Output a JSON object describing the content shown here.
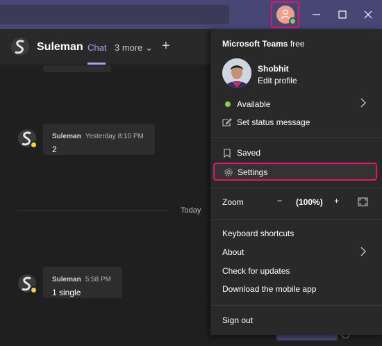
{
  "header": {
    "contact_name": "Suleman",
    "tab_chat": "Chat",
    "tab_more": "3 more",
    "add_tab": "+"
  },
  "messages": [
    {
      "sender": "Suleman",
      "time": "Yesterday 8:10 PM",
      "text": "2"
    },
    {
      "sender": "Suleman",
      "time": "5:58 PM",
      "text": "1 single"
    }
  ],
  "divider": {
    "label": "Today"
  },
  "menu": {
    "product": "Microsoft Teams",
    "tier": "free",
    "profile_name": "Shobhit",
    "edit_profile": "Edit profile",
    "status": "Available",
    "set_status": "Set status message",
    "saved": "Saved",
    "settings": "Settings",
    "zoom_label": "Zoom",
    "zoom_minus": "−",
    "zoom_value": "(100%)",
    "zoom_plus": "+",
    "keyboard_shortcuts": "Keyboard shortcuts",
    "about": "About",
    "check_updates": "Check for updates",
    "download_mobile": "Download the mobile app",
    "sign_out": "Sign out"
  },
  "colors": {
    "titlebar": "#464775",
    "accent": "#a5a7e5",
    "highlight": "#e0166d",
    "available": "#92c353",
    "away": "#f8d22a"
  },
  "icons": [
    "search-icon",
    "profile-avatar-icon",
    "minimize-icon",
    "maximize-icon",
    "close-icon",
    "chevron-right-icon",
    "bookmark-icon",
    "gear-icon",
    "fullscreen-icon",
    "edit-status-icon"
  ]
}
